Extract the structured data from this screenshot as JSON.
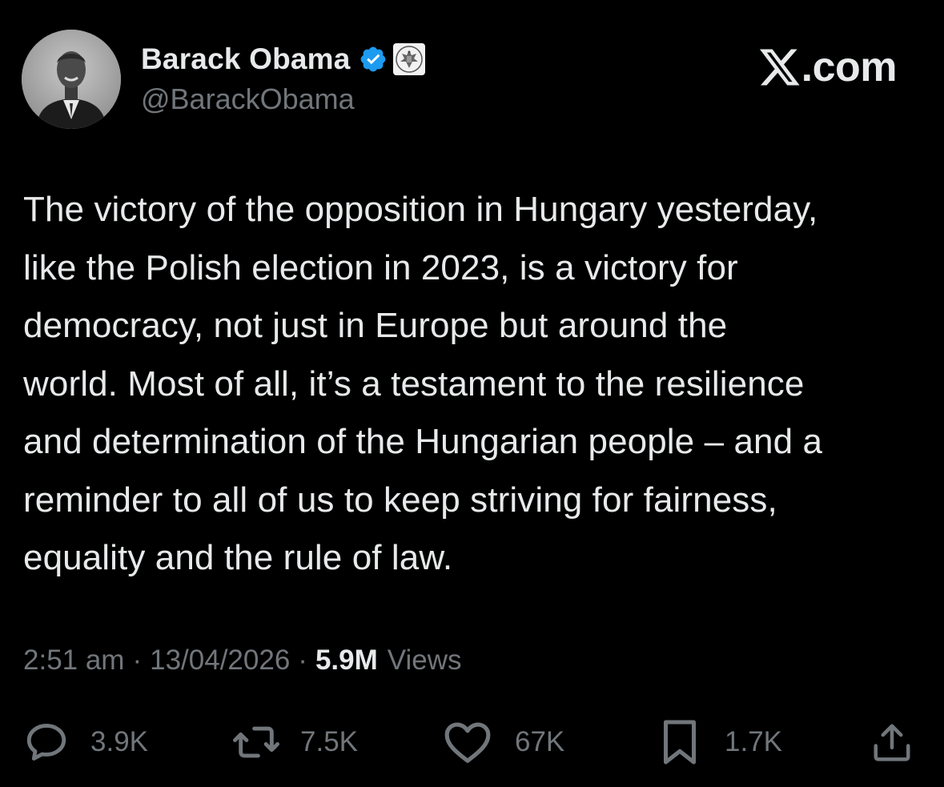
{
  "author": {
    "display_name": "Barack Obama",
    "handle": "@BarackObama",
    "avatar_icon": "profile-photo",
    "verified_icon": "verified-badge-icon",
    "affiliate_icon": "government-seal-icon"
  },
  "brand": {
    "text": ".com",
    "logo_icon": "x-logo-icon"
  },
  "tweet": {
    "text": "The victory of the opposition in Hungary yesterday,\nlike the Polish election in 2023, is a victory for\ndemocracy, not just in Europe but around the\nworld. Most of all, it’s a testament to the resilience\nand determination of the Hungarian people – and a\nreminder to all of us to keep striving for fairness,\nequality and the rule of law."
  },
  "meta": {
    "time": "2:51 am",
    "separator": "·",
    "date": "13/04/2026",
    "views_count": "5.9M",
    "views_label": "Views"
  },
  "actions": {
    "replies": {
      "icon": "reply-icon",
      "count": "3.9K"
    },
    "reposts": {
      "icon": "repost-icon",
      "count": "7.5K"
    },
    "likes": {
      "icon": "like-icon",
      "count": "67K"
    },
    "bookmarks": {
      "icon": "bookmark-icon",
      "count": "1.7K"
    },
    "share": {
      "icon": "share-icon"
    }
  },
  "colors": {
    "background": "#000000",
    "primary_text": "#e7e9ea",
    "secondary_text": "#71767b",
    "verified_blue": "#1d9bf0"
  }
}
